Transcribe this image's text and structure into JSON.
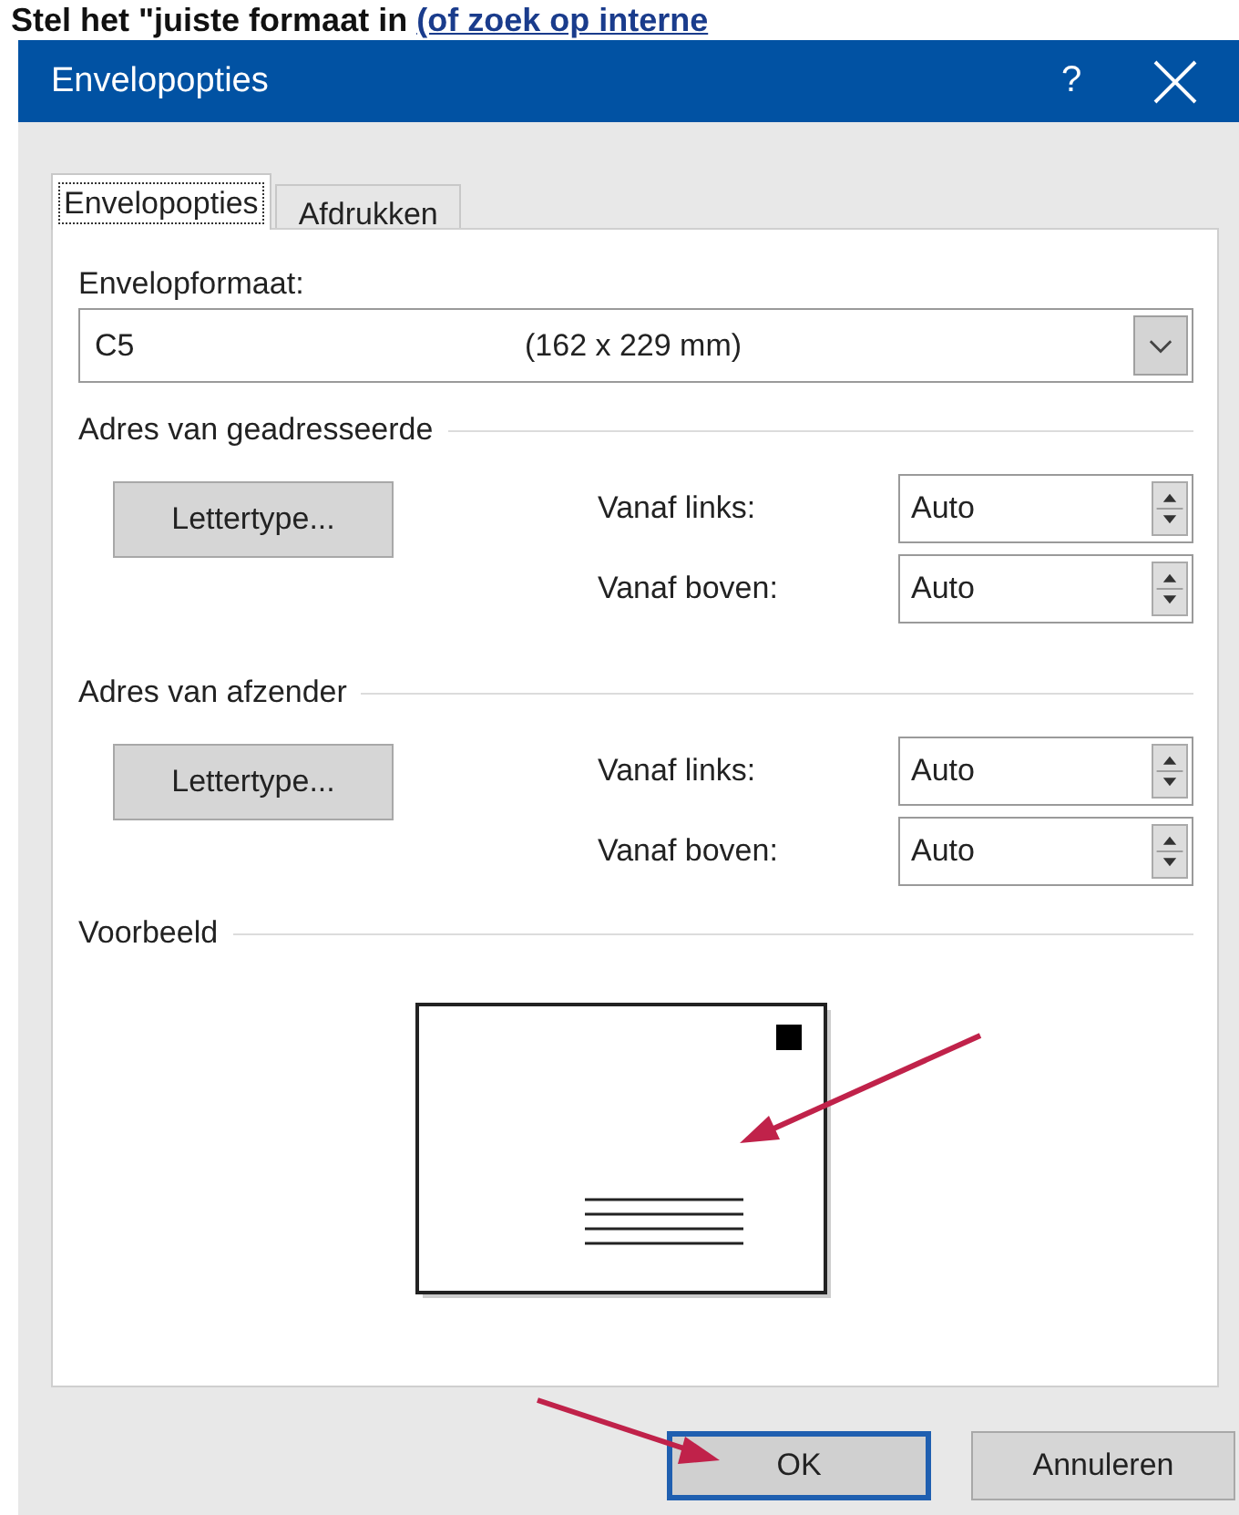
{
  "heading": {
    "text": "Stel het \"juiste formaat in",
    "link": "(of zoek op interne"
  },
  "window": {
    "title": "Envelopopties",
    "help": "?"
  },
  "tabs": [
    {
      "label": "Envelopopties",
      "selected": true
    },
    {
      "label": "Afdrukken",
      "selected": false
    }
  ],
  "envelope_size": {
    "label": "Envelopformaat:",
    "name": "C5",
    "dimensions": "(162 x 229 mm)"
  },
  "groups": [
    {
      "title": "Adres van geadresseerde",
      "font_button": "Lettertype...",
      "fields": [
        {
          "label": "Vanaf links:",
          "value": "Auto"
        },
        {
          "label": "Vanaf boven:",
          "value": "Auto"
        }
      ]
    },
    {
      "title": "Adres van afzender",
      "font_button": "Lettertype...",
      "fields": [
        {
          "label": "Vanaf links:",
          "value": "Auto"
        },
        {
          "label": "Vanaf boven:",
          "value": "Auto"
        }
      ]
    }
  ],
  "preview": {
    "title": "Voorbeeld"
  },
  "buttons": [
    {
      "label": "OK",
      "default": true
    },
    {
      "label": "Annuleren",
      "default": false
    }
  ]
}
